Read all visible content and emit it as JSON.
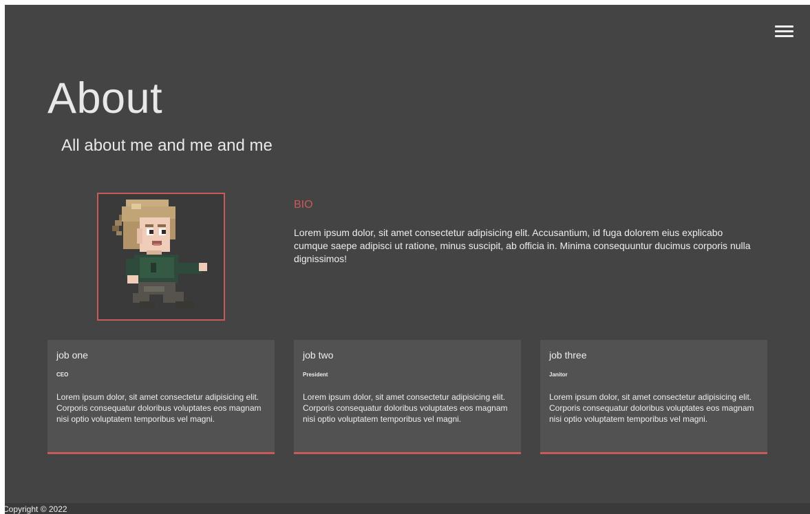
{
  "header": {
    "menu_icon": "hamburger-menu-icon"
  },
  "hero": {
    "title": "About",
    "subtitle": "All about me and me and me"
  },
  "bio": {
    "heading": "BIO",
    "text": "Lorem ipsum dolor, sit amet consectetur adipisicing elit. Accusantium, id fuga dolorem eius explicabo cumque saepe adipisci ut ratione, minus suscipit, ab officia in. Minima consequuntur ducimus corporis nulla dignissimos!",
    "portrait_icon": "pixel-character-avatar"
  },
  "jobs": [
    {
      "title": "job one",
      "role": "CEO",
      "description": "Lorem ipsum dolor, sit amet consectetur adipisicing elit. Corporis consequatur doloribus voluptates eos magnam nisi optio voluptatem temporibus vel magni."
    },
    {
      "title": "job two",
      "role": "President",
      "description": "Lorem ipsum dolor, sit amet consectetur adipisicing elit. Corporis consequatur doloribus voluptates eos magnam nisi optio voluptatem temporibus vel magni."
    },
    {
      "title": "job three",
      "role": "Janitor",
      "description": "Lorem ipsum dolor, sit amet consectetur adipisicing elit. Corporis consequatur doloribus voluptates eos magnam nisi optio voluptatem temporibus vel magni."
    }
  ],
  "footer": {
    "copyright": "Copyright © 2022"
  },
  "colors": {
    "background": "#444444",
    "card": "#525252",
    "accent": "#c95a5a",
    "footer": "#3a3a3a",
    "text": "#eeeeee"
  }
}
